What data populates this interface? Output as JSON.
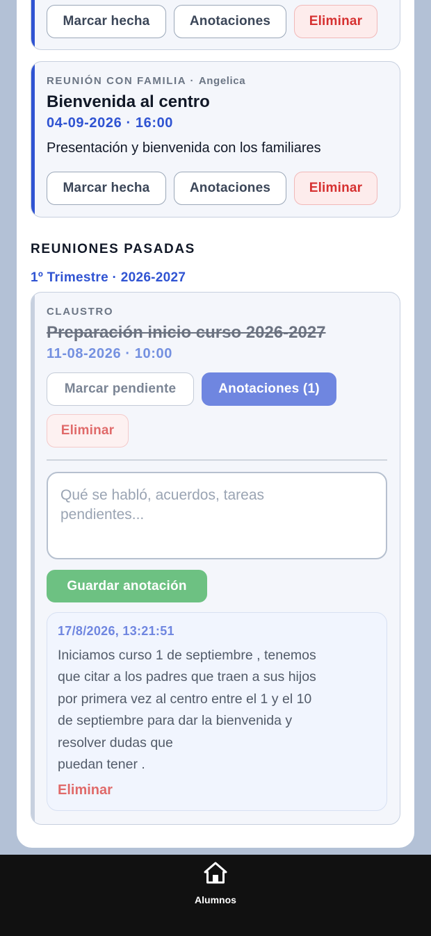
{
  "colors": {
    "accent_blue": "#2f53d2",
    "past_accent": "#c7d0df",
    "danger": "#d63131",
    "primary": "#6f86e0",
    "save": "#6dc182",
    "tabbar": "#111111"
  },
  "upcoming": [
    {
      "buttons": {
        "mark": "Marcar hecha",
        "notes": "Anotaciones",
        "delete": "Eliminar"
      }
    },
    {
      "type": "REUNIÓN CON FAMILIA",
      "separator": "·",
      "with": "Angelica",
      "title": "Bienvenida al centro",
      "datetime": "04-09-2026 · 16:00",
      "description": "Presentación y bienvenida con los familiares",
      "buttons": {
        "mark": "Marcar hecha",
        "notes": "Anotaciones",
        "delete": "Eliminar"
      }
    }
  ],
  "past_section": {
    "title": "REUNIONES PASADAS",
    "period": "1º Trimestre · 2026-2027"
  },
  "past_meeting": {
    "type": "CLAUSTRO",
    "title": "Preparación inicio curso 2026-2027",
    "datetime": "11-08-2026 · 10:00",
    "buttons": {
      "mark": "Marcar pendiente",
      "notes": "Anotaciones (1)",
      "delete": "Eliminar"
    },
    "note_input": {
      "placeholder_line1": "Qué se habló, acuerdos, tareas",
      "placeholder_line2": "pendientes..."
    },
    "save_label": "Guardar anotación",
    "note": {
      "timestamp": "17/8/2026, 13:21:51",
      "lines": [
        "Iniciamos curso 1 de septiembre , tenemos",
        "que citar a los padres que traen a sus hijos",
        "por primera vez al centro entre el 1 y el 10",
        "de septiembre para dar la bienvenida y",
        "resolver dudas que",
        "puedan tener ."
      ],
      "delete_label": "Eliminar"
    }
  },
  "tabbar": {
    "home_icon": "home-icon",
    "label": "Alumnos"
  }
}
